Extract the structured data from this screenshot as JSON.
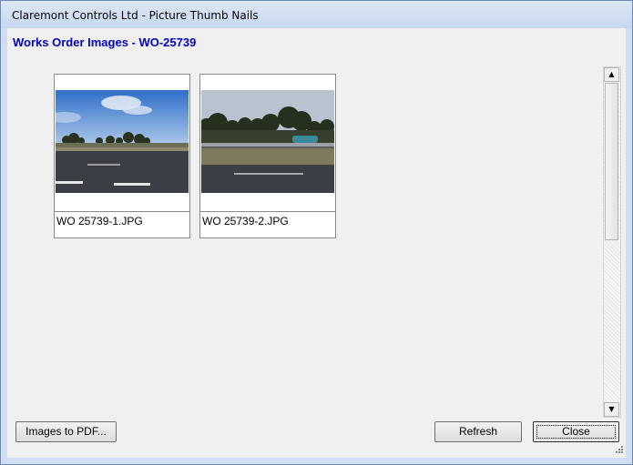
{
  "window": {
    "title": "Claremont Controls Ltd - Picture Thumb Nails"
  },
  "heading": "Works Order Images - WO-25739",
  "thumbnails": [
    {
      "filename": "WO 25739-1.JPG"
    },
    {
      "filename": "WO 25739-2.JPG"
    }
  ],
  "buttons": {
    "images_to_pdf": "Images to PDF...",
    "refresh": "Refresh",
    "close": "Close"
  },
  "icons": {
    "scroll_up": "triangle-up-icon",
    "scroll_down": "triangle-down-icon",
    "resize_grip": "resize-grip-icon"
  },
  "colors": {
    "heading": "#0000c8"
  }
}
